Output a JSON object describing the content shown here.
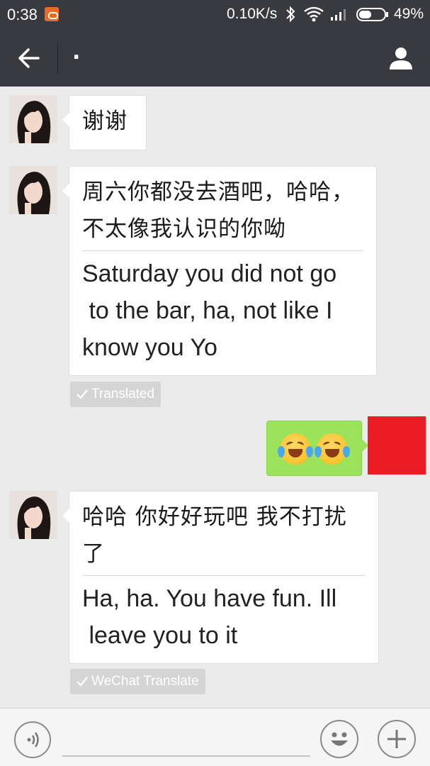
{
  "status_bar": {
    "time": "0:38",
    "network_speed": "0.10K/s",
    "battery_percent": "49%",
    "battery_level": 0.49,
    "app_icon": "orange-app-icon",
    "bluetooth_icon": "bluetooth-icon",
    "wifi_icon": "wifi-icon",
    "signal_icon": "signal-icon"
  },
  "header": {
    "title": ".",
    "back_icon": "back-arrow-icon",
    "profile_icon": "person-icon",
    "background": "#393a3f"
  },
  "messages": [
    {
      "direction": "incoming",
      "text": "谢谢"
    },
    {
      "direction": "incoming",
      "text_lines": [
        "周六你都没去酒吧，哈哈，",
        "不太像我认识的你呦"
      ],
      "translation_lines": [
        "Saturday you did not go",
        " to the bar, ha, not like I",
        "know you Yo"
      ],
      "badge": "Translated"
    },
    {
      "direction": "outgoing",
      "emoji": [
        "face-with-tears-of-joy",
        "face-with-tears-of-joy"
      ],
      "bubble_color": "#9be35a",
      "redacted_avatar_color": "#ec1c24"
    },
    {
      "direction": "incoming",
      "text_lines": [
        "哈哈 你好好玩吧 我不打扰",
        "了"
      ],
      "translation_lines": [
        "Ha, ha. You have fun. Ill",
        " leave you to it"
      ],
      "badge": "WeChat Translate"
    }
  ],
  "input_bar": {
    "voice_icon": "voice-input-icon",
    "emoji_icon": "smiley-icon",
    "plus_icon": "plus-icon",
    "placeholder": ""
  }
}
